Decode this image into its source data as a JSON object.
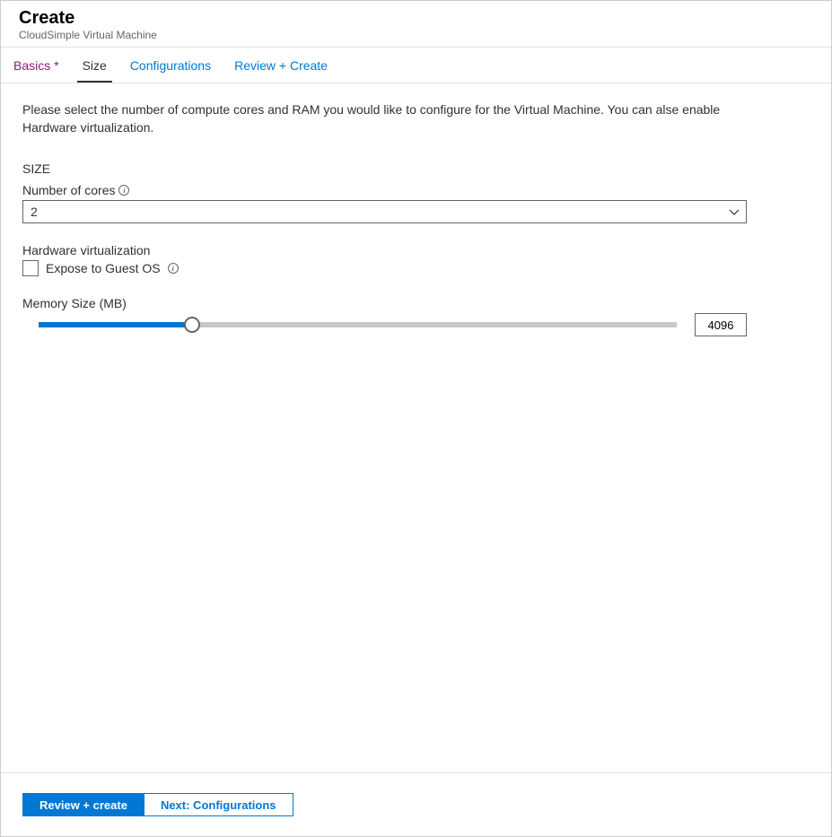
{
  "header": {
    "title": "Create",
    "subtitle": "CloudSimple Virtual Machine"
  },
  "tabs": {
    "basics": "Basics *",
    "size": "Size",
    "configurations": "Configurations",
    "review": "Review + Create"
  },
  "content": {
    "intro": "Please select the number of compute cores and RAM you would like to configure for the Virtual Machine. You can alse enable Hardware virtualization.",
    "section_heading": "SIZE",
    "cores_label": "Number of cores",
    "cores_value": "2",
    "hw_virt_label": "Hardware virtualization",
    "hw_virt_checkbox_label": "Expose to Guest OS",
    "memory_label": "Memory Size (MB)",
    "memory_value": "4096"
  },
  "footer": {
    "review_button": "Review + create",
    "next_button": "Next: Configurations"
  }
}
